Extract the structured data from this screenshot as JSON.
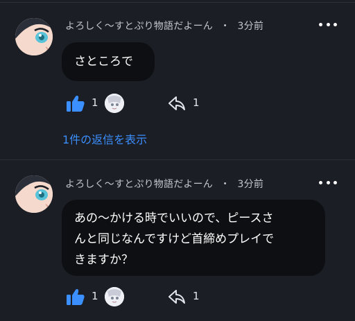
{
  "comments": [
    {
      "author": "よろしく〜すとぷり物語だよーん",
      "separator": "・",
      "time": "3分前",
      "text": "さところで",
      "like_count": "1",
      "reply_count": "1"
    },
    {
      "author": "よろしく〜すとぷり物語だよーん",
      "separator": "・",
      "time": "3分前",
      "text_lines": [
        "あの〜かける時でいいので、ピースさ",
        "んと同じなんですけど首締めプレイで",
        "きますか？"
      ],
      "like_count": "1",
      "reply_count": "1"
    }
  ],
  "replies_link": "1件の返信を表示",
  "icons": {
    "like": "thumbs-up-icon",
    "reply": "reply-arrow-icon",
    "more": "more-dots-icon"
  },
  "colors": {
    "background": "#1b1e25",
    "bubble": "#0d0f12",
    "accent": "#3b8fff"
  }
}
